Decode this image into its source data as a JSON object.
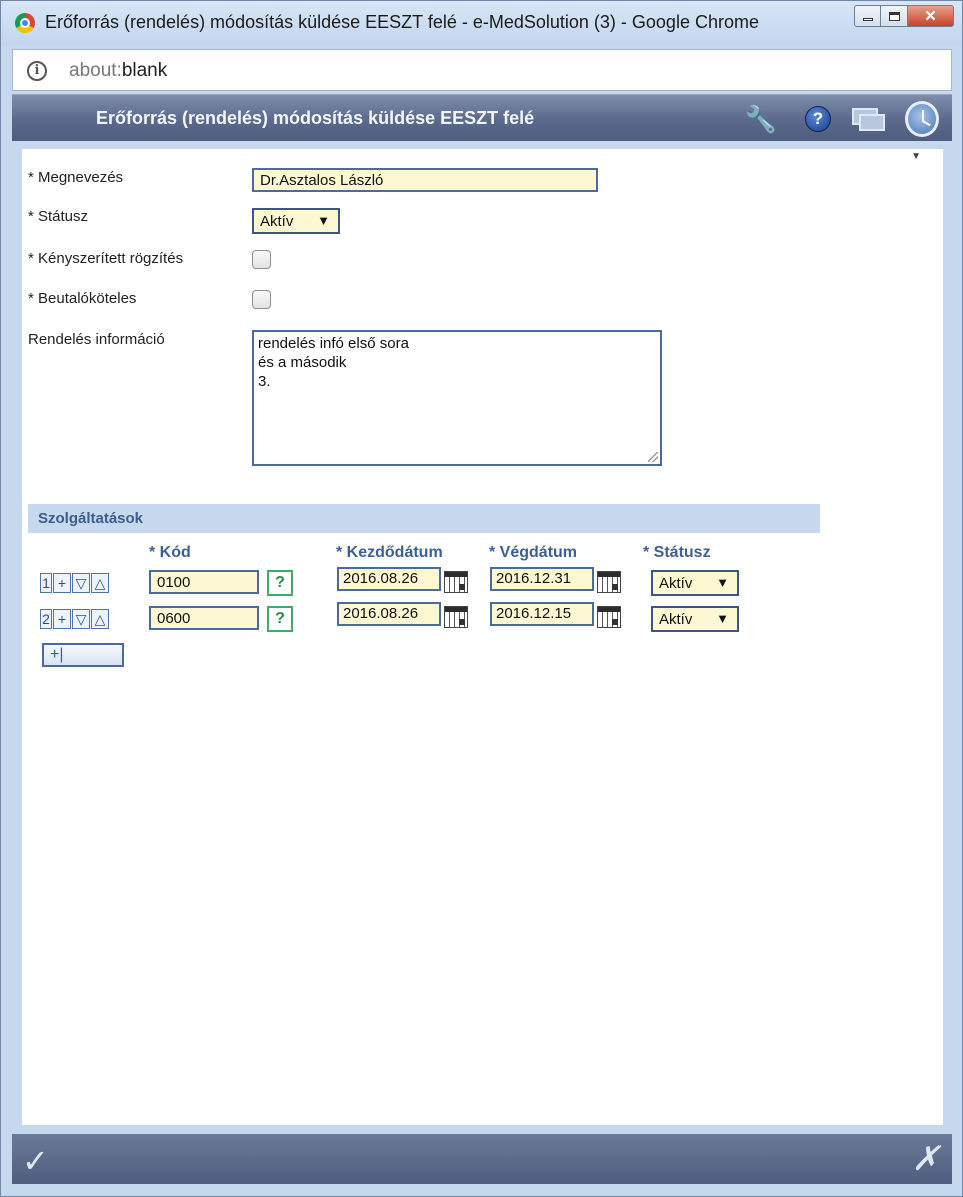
{
  "window": {
    "title": "Erőforrás (rendelés) módosítás küldése EESZT felé - e-MedSolution (3) - Google Chrome",
    "close_glyph": "✕"
  },
  "address": {
    "scheme": "about:",
    "path": "blank"
  },
  "header": {
    "title": "Erőforrás (rendelés) módosítás küldése EESZT felé",
    "help_glyph": "?"
  },
  "form": {
    "name_label": "* Megnevezés",
    "name_value": "Dr.Asztalos László",
    "status_label": "* Státusz",
    "status_value": "Aktív",
    "forced_label": "* Kényszerített rögzítés",
    "referral_label": "* Beutalóköteles",
    "info_label": "Rendelés információ",
    "info_lines": [
      "rendelés infó első sora",
      "és a második",
      "3."
    ]
  },
  "services": {
    "section_title": "Szolgáltatások",
    "columns": {
      "code": "* Kód",
      "start": "* Kezdődátum",
      "end": "* Végdátum",
      "status": "* Státusz"
    },
    "rows": [
      {
        "num": "1",
        "code": "0100",
        "start": "2016.08.26",
        "end": "2016.12.31",
        "status": "Aktív"
      },
      {
        "num": "2",
        "code": "0600",
        "start": "2016.08.26",
        "end": "2016.12.15",
        "status": "Aktív"
      }
    ],
    "add_label": "+|",
    "help_glyph": "?"
  },
  "footer": {
    "ok_glyph": "✓",
    "cancel_glyph": "✗"
  }
}
